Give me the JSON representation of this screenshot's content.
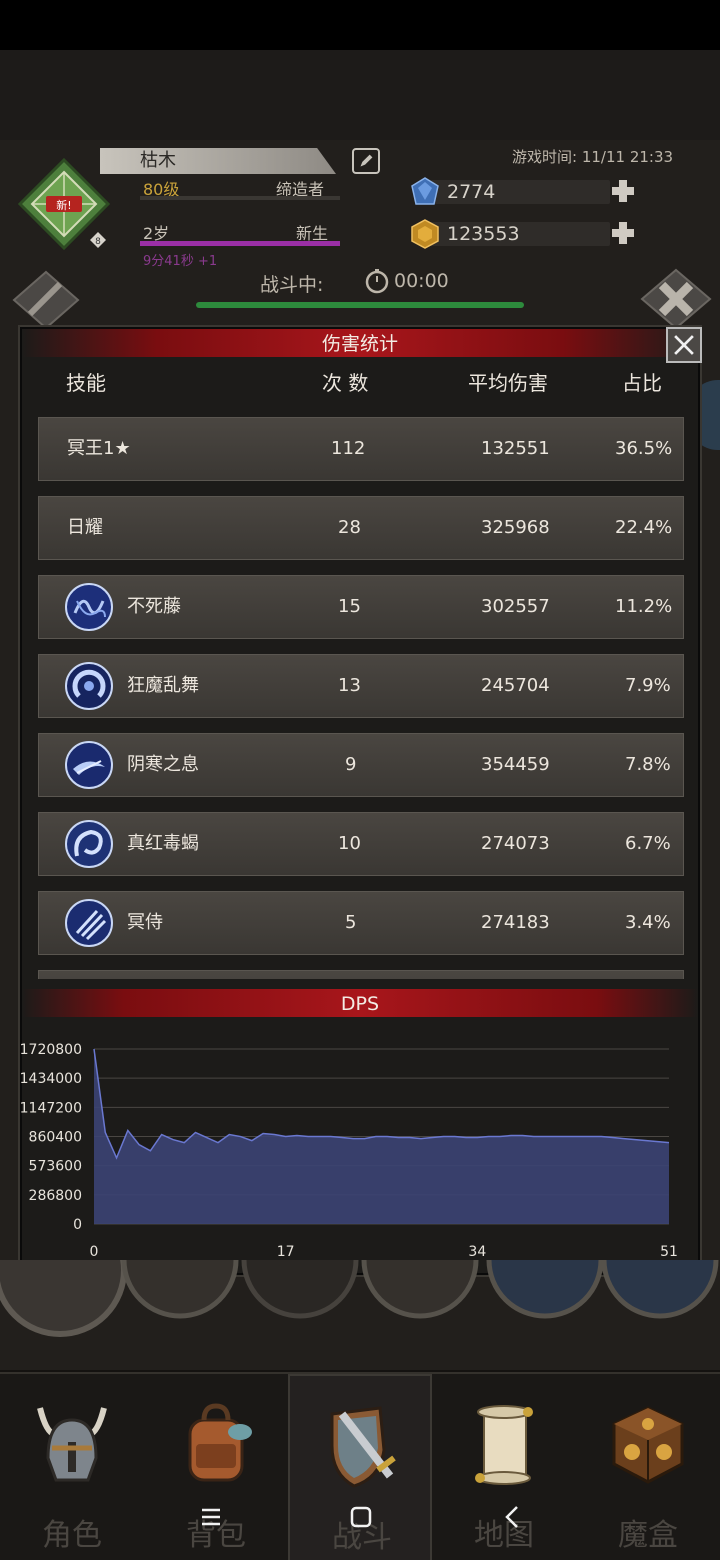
{
  "player": {
    "name": "枯木",
    "level": "80级",
    "class_title": "缔造者",
    "age": "2岁",
    "age_status": "新生",
    "age_timer": "9分41秒 +1",
    "badge_tag": "新!",
    "badge_level": "8"
  },
  "game_time": "游戏时间: 11/11 21:33",
  "resources": {
    "gems": "2774",
    "gold": "123553"
  },
  "battle": {
    "label": "战斗中:",
    "timer": "00:00"
  },
  "panel": {
    "title": "伤害统计",
    "columns": {
      "skill": "技能",
      "count": "次 数",
      "avg": "平均伤害",
      "share": "占比"
    },
    "rows": [
      {
        "skill": "冥王1★",
        "count": "112",
        "avg": "132551",
        "share": "36.5%",
        "icon": "none"
      },
      {
        "skill": "日耀",
        "count": "28",
        "avg": "325968",
        "share": "22.4%",
        "icon": "none"
      },
      {
        "skill": "不死藤",
        "count": "15",
        "avg": "302557",
        "share": "11.2%",
        "icon": "vine-skill-icon"
      },
      {
        "skill": "狂魔乱舞",
        "count": "13",
        "avg": "245704",
        "share": "7.9%",
        "icon": "swirl-skill-icon"
      },
      {
        "skill": "阴寒之息",
        "count": "9",
        "avg": "354459",
        "share": "7.8%",
        "icon": "frost-breath-skill-icon"
      },
      {
        "skill": "真红毒蝎",
        "count": "10",
        "avg": "274073",
        "share": "6.7%",
        "icon": "scorpion-skill-icon"
      },
      {
        "skill": "冥侍",
        "count": "5",
        "avg": "274183",
        "share": "3.4%",
        "icon": "claw-skill-icon"
      }
    ]
  },
  "chart_data": {
    "type": "area",
    "title": "DPS",
    "xlabel": "",
    "ylabel": "",
    "xlim": [
      0,
      51
    ],
    "ylim": [
      0,
      1720800
    ],
    "x_ticks": [
      "0",
      "17",
      "34",
      "51"
    ],
    "y_ticks": [
      "1720800",
      "1434000",
      "1147200",
      "860400",
      "573600",
      "286800",
      "0"
    ],
    "grid": true,
    "fill_color": "#3c4474",
    "line_color": "#6a78d0",
    "series": [
      {
        "x": [
          0,
          1,
          2,
          3,
          4,
          5,
          6,
          7,
          8,
          9,
          10,
          11,
          12,
          13,
          14,
          15,
          16,
          17,
          18,
          19,
          20,
          21,
          22,
          23,
          24,
          25,
          26,
          27,
          28,
          29,
          30,
          31,
          32,
          33,
          34,
          35,
          36,
          37,
          38,
          39,
          40,
          41,
          42,
          43,
          44,
          45,
          46,
          47,
          48,
          49,
          50,
          51
        ],
        "values": [
          1720800,
          900000,
          650000,
          920000,
          780000,
          720000,
          880000,
          830000,
          800000,
          900000,
          850000,
          800000,
          880000,
          860000,
          820000,
          890000,
          880000,
          860000,
          870000,
          860000,
          860000,
          860000,
          850000,
          840000,
          840000,
          860000,
          860000,
          850000,
          850000,
          840000,
          850000,
          860000,
          860000,
          850000,
          850000,
          860000,
          860000,
          870000,
          870000,
          860000,
          860000,
          860000,
          860000,
          860000,
          860000,
          860000,
          850000,
          840000,
          830000,
          820000,
          810000,
          800000
        ]
      }
    ]
  },
  "nav": {
    "items": [
      {
        "label": "角色"
      },
      {
        "label": "背包"
      },
      {
        "label": "战斗"
      },
      {
        "label": "地图"
      },
      {
        "label": "魔盒"
      }
    ]
  }
}
